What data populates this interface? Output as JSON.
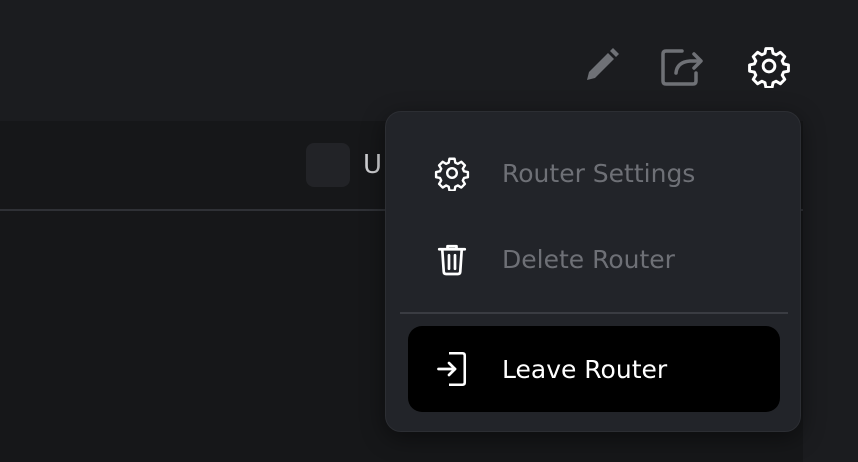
{
  "toolbar": {
    "edit_icon": "pencil-icon",
    "share_icon": "share-icon",
    "settings_icon": "gear-icon"
  },
  "panel": {
    "username_initial": "U"
  },
  "menu": {
    "items": [
      {
        "label": "Router Settings",
        "icon": "gear-icon",
        "enabled": false
      },
      {
        "label": "Delete Router",
        "icon": "trash-icon",
        "enabled": false
      },
      {
        "label": "Leave Router",
        "icon": "exit-icon",
        "enabled": true
      }
    ]
  },
  "colors": {
    "background": "#1b1c1f",
    "menu_background": "#222429",
    "disabled_text": "#6e7076",
    "highlight_background": "#000000",
    "highlight_text": "#ffffff"
  }
}
